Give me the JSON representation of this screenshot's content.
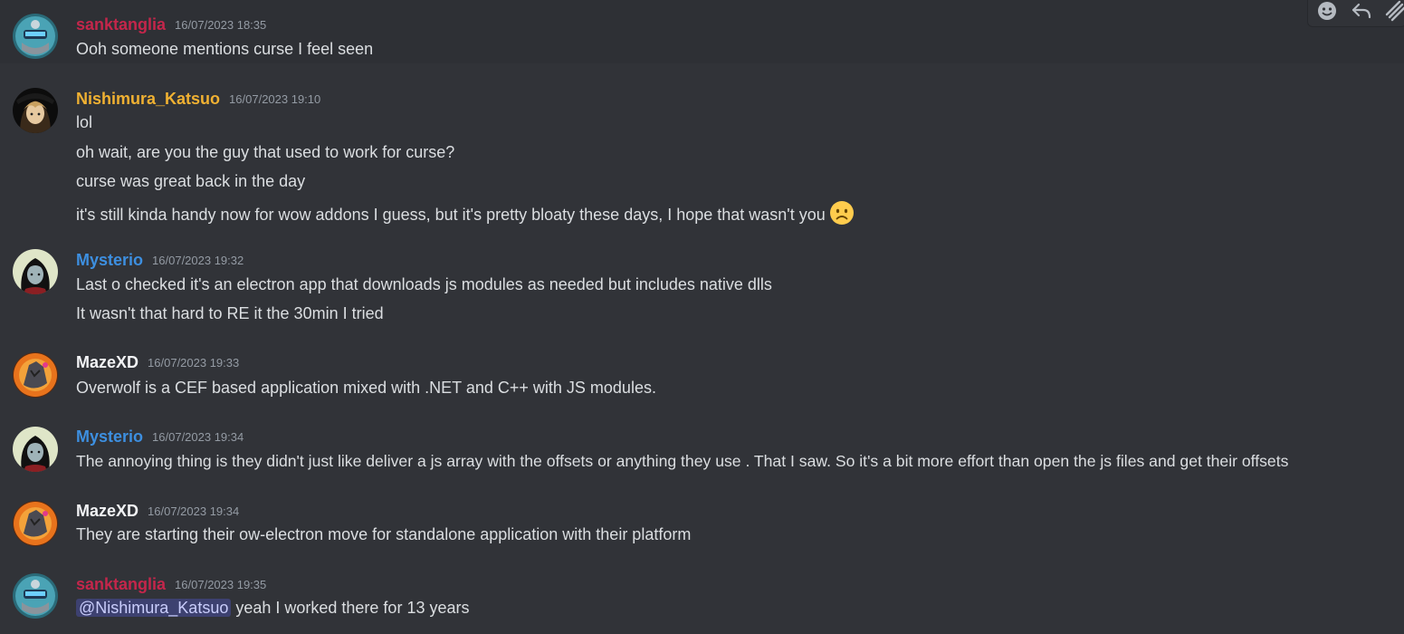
{
  "colors": {
    "background": "#313338",
    "hover_background": "#2e3035",
    "sanktanglia": "#c4264b",
    "nishimura": "#f0b132",
    "mysterio": "#3d8fe0",
    "mazexd": "#f2f3f5",
    "timestamp": "#949ba4",
    "text": "#dbdee1",
    "mention_bg": "#3c4270"
  },
  "toolbar": {
    "icons": [
      "add-reaction-icon",
      "reply-icon",
      "more-icon"
    ]
  },
  "messages": [
    {
      "user": "sanktanglia",
      "time": "16/07/2023 18:35",
      "lines": [
        "Ooh someone mentions curse I feel seen"
      ]
    },
    {
      "user": "Nishimura_Katsuo",
      "time": "16/07/2023 19:10",
      "lines": [
        "lol",
        "oh wait, are you the guy that used to work for curse?",
        "curse was great back in the day",
        "it's still kinda handy now for wow addons I guess, but it's pretty bloaty these days, I hope that wasn't you"
      ],
      "emoji": "frowning-face-emoji"
    },
    {
      "user": "Mysterio",
      "time": "16/07/2023 19:32",
      "lines": [
        "Last o checked it's an electron app that downloads js modules as needed but includes native dlls",
        "It wasn't that hard to RE it the 30min I tried"
      ]
    },
    {
      "user": "MazeXD",
      "time": "16/07/2023 19:33",
      "lines": [
        "Overwolf is a CEF based application mixed with .NET and C++ with JS modules."
      ]
    },
    {
      "user": "Mysterio",
      "time": "16/07/2023 19:34",
      "lines": [
        "The annoying thing is they didn't just like deliver a js array with the offsets or anything they use . That I saw. So it's a bit more effort than open the js files and get their offsets"
      ]
    },
    {
      "user": "MazeXD",
      "time": "16/07/2023 19:34",
      "lines": [
        "They are starting their ow-electron move for standalone application with their platform"
      ]
    },
    {
      "user": "sanktanglia",
      "time": "16/07/2023 19:35",
      "mention": "@Nishimura_Katsuo",
      "lines": [
        " yeah I worked there for 13 years"
      ]
    }
  ]
}
